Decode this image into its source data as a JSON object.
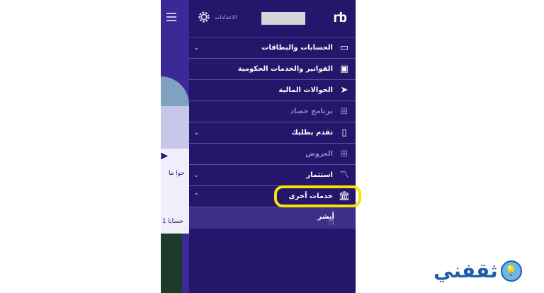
{
  "header": {
    "logo": "rb",
    "settings_label": "الاعدادات"
  },
  "menu": [
    {
      "label": "الحسابات والبطاقات",
      "icon": "card-icon",
      "expandable": true,
      "chevron": "⌄",
      "disabled": false
    },
    {
      "label": "الفواتير والخدمات الحكومية",
      "icon": "toolbox-icon",
      "expandable": false,
      "disabled": false
    },
    {
      "label": "الحوالات المالية",
      "icon": "send-icon",
      "expandable": false,
      "disabled": false
    },
    {
      "label": "برنامج حصاد",
      "icon": "gift-icon",
      "expandable": false,
      "disabled": true
    },
    {
      "label": "تقدم بطلبك",
      "icon": "phone-icon",
      "expandable": true,
      "chevron": "⌄",
      "disabled": false
    },
    {
      "label": "العروض",
      "icon": "gift-icon",
      "expandable": false,
      "disabled": true
    },
    {
      "label": "استثمار",
      "icon": "chart-icon",
      "expandable": true,
      "chevron": "⌄",
      "disabled": false
    },
    {
      "label": "خدمات أخرى",
      "icon": "bank-icon",
      "expandable": true,
      "chevron": "⌃",
      "disabled": false
    }
  ],
  "submenu": {
    "label": "أبشر"
  },
  "background": {
    "text1": "حوا ما",
    "text2": "1 حسابا"
  },
  "watermark": {
    "text": "ثقفني"
  },
  "colors": {
    "drawer_bg": "#24166a",
    "highlight": "#f4e300"
  }
}
